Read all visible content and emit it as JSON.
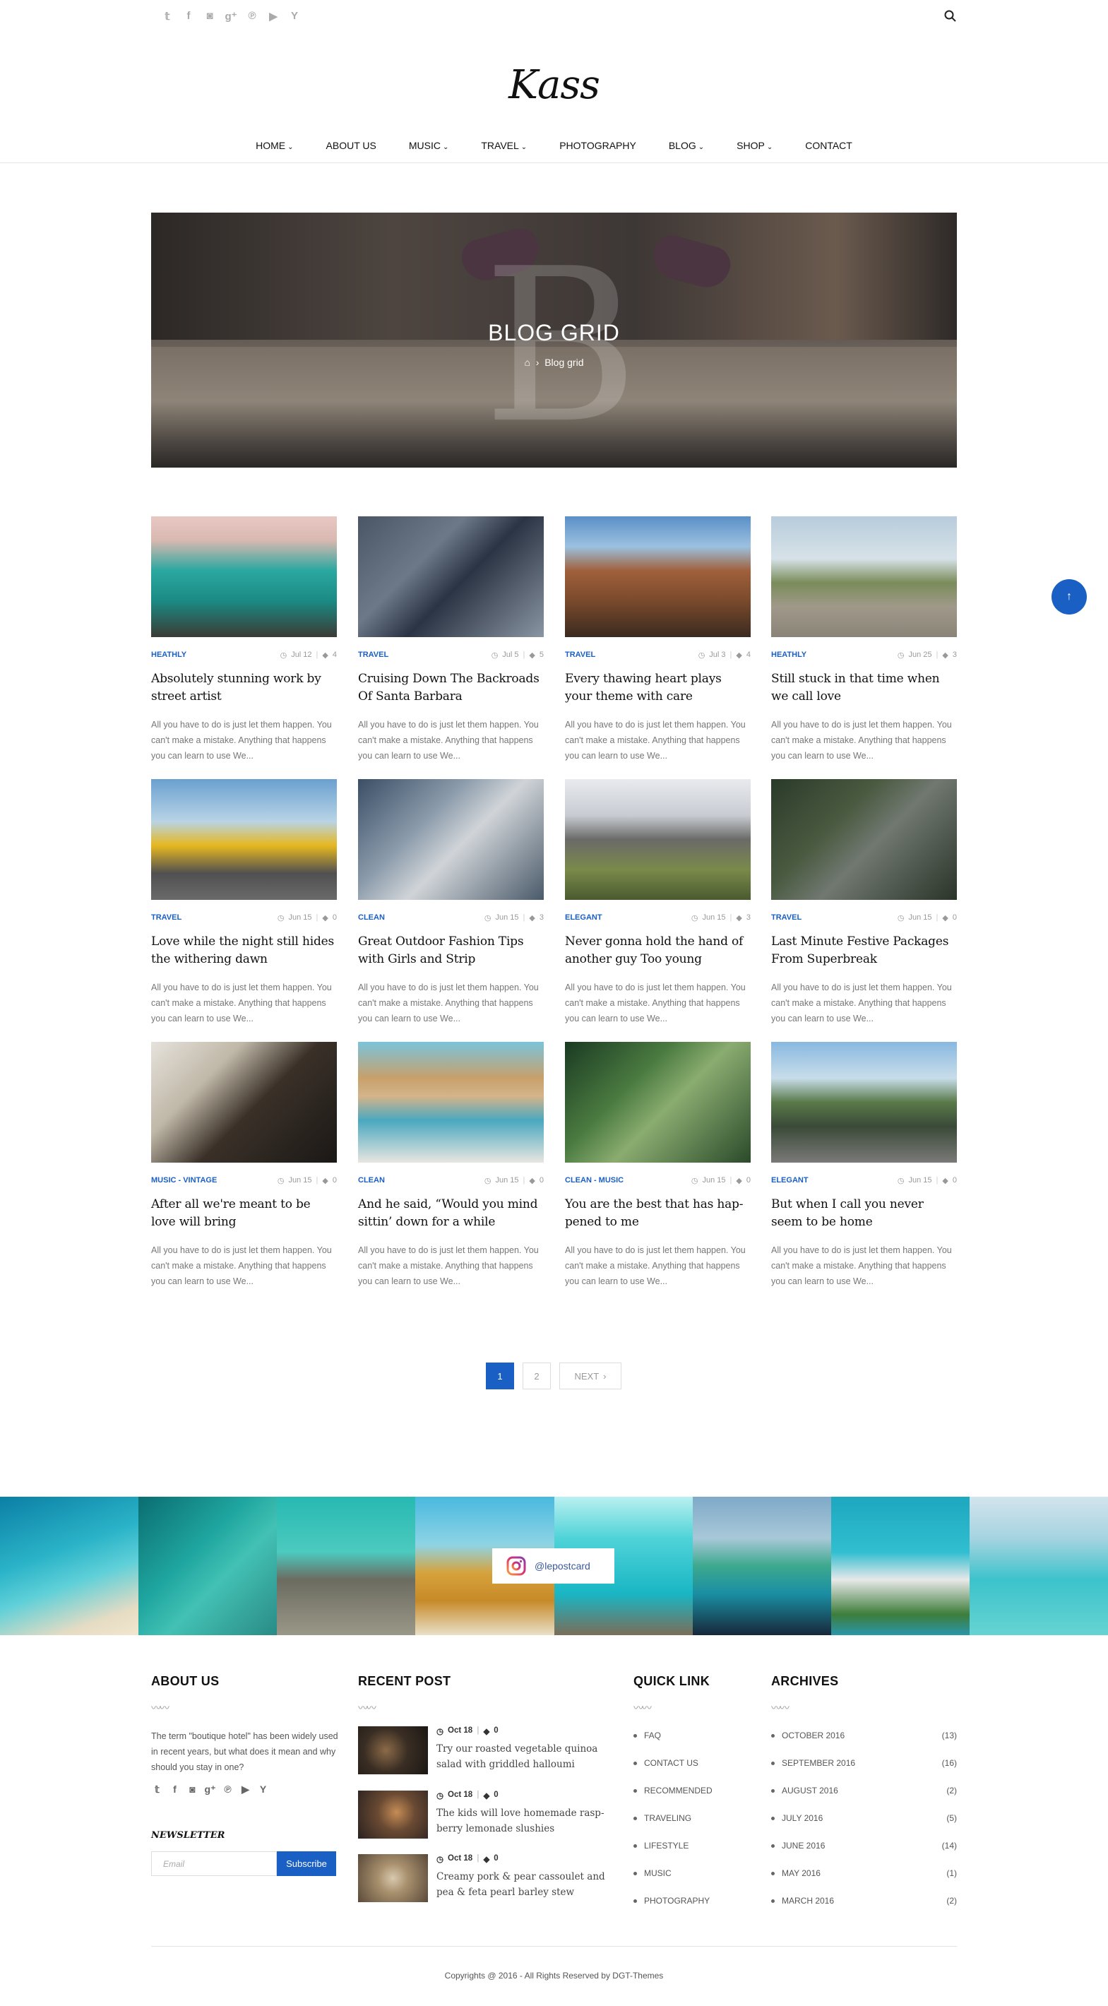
{
  "social_icons": [
    "twitter-icon",
    "facebook-icon",
    "instagram-icon",
    "google-plus-icon",
    "pinterest-icon",
    "youtube-icon",
    "hacker-news-icon"
  ],
  "site": {
    "logo": "Kass"
  },
  "nav": [
    {
      "label": "HOME",
      "dropdown": true
    },
    {
      "label": "ABOUT US",
      "dropdown": false
    },
    {
      "label": "MUSIC",
      "dropdown": true
    },
    {
      "label": "TRAVEL",
      "dropdown": true
    },
    {
      "label": "PHOTOGRAPHY",
      "dropdown": false
    },
    {
      "label": "BLOG",
      "dropdown": true
    },
    {
      "label": "SHOP",
      "dropdown": true
    },
    {
      "label": "CONTACT",
      "dropdown": false
    }
  ],
  "hero": {
    "title": "BLOG GRID",
    "breadcrumb": "Blog grid"
  },
  "colors": {
    "accent": "#1a5fc4"
  },
  "posts": [
    {
      "category": "HEATHLY",
      "date": "Jul 12",
      "comments": "4",
      "title": "Absolutely stunning work by street artist",
      "excerpt": "All you have to do is just let them happen. You can't make a mistake. Anything that happens you can learn to use We..."
    },
    {
      "category": "TRAVEL",
      "date": "Jul 5",
      "comments": "5",
      "title": "Cruising Down The Backroads Of Santa Barbara",
      "excerpt": "All you have to do is just let them happen. You can't make a mistake. Anything that happens you can learn to use We..."
    },
    {
      "category": "TRAVEL",
      "date": "Jul 3",
      "comments": "4",
      "title": "Every thawing heart plays your theme with care",
      "excerpt": "All you have to do is just let them happen. You can't make a mistake. Anything that happens you can learn to use We..."
    },
    {
      "category": "HEATHLY",
      "date": "Jun 25",
      "comments": "3",
      "title": "Still stuck in that time when we call love",
      "excerpt": "All you have to do is just let them happen. You can't make a mistake. Anything that happens you can learn to use We..."
    },
    {
      "category": "TRAVEL",
      "date": "Jun 15",
      "comments": "0",
      "title": "Love while the night still hides the withering dawn",
      "excerpt": "All you have to do is just let them happen. You can't make a mistake. Anything that happens you can learn to use We..."
    },
    {
      "category": "CLEAN",
      "date": "Jun 15",
      "comments": "3",
      "title": "Great Outdoor Fashion Tips with Girls and Strip",
      "excerpt": "All you have to do is just let them happen. You can't make a mistake. Anything that happens you can learn to use We..."
    },
    {
      "category": "ELEGANT",
      "date": "Jun 15",
      "comments": "3",
      "title": "Never gonna hold the hand of another guy Too young",
      "excerpt": "All you have to do is just let them happen. You can't make a mistake. Anything that happens you can learn to use We..."
    },
    {
      "category": "TRAVEL",
      "date": "Jun 15",
      "comments": "0",
      "title": "Last Minute Festive Packages From Superbreak",
      "excerpt": "All you have to do is just let them happen. You can't make a mistake. Anything that happens you can learn to use We..."
    },
    {
      "category": "MUSIC - VINTAGE",
      "date": "Jun 15",
      "comments": "0",
      "title": "After all we're meant to be love will bring",
      "excerpt": "All you have to do is just let them happen. You can't make a mistake. Anything that happens you can learn to use We..."
    },
    {
      "category": "CLEAN",
      "date": "Jun 15",
      "comments": "0",
      "title": "And he said, “Would you mind sittin’ down for a while",
      "excerpt": "All you have to do is just let them happen. You can't make a mistake. Anything that happens you can learn to use We..."
    },
    {
      "category": "CLEAN - MUSIC",
      "date": "Jun 15",
      "comments": "0",
      "title": "You are the best that has hap-pened to me",
      "excerpt": "All you have to do is just let them happen. You can't make a mistake. Anything that happens you can learn to use We..."
    },
    {
      "category": "ELEGANT",
      "date": "Jun 15",
      "comments": "0",
      "title": "But when I call you never seem to be home",
      "excerpt": "All you have to do is just let them happen. You can't make a mistake. Anything that happens you can learn to use We..."
    }
  ],
  "pagination": {
    "pages": [
      "1",
      "2"
    ],
    "current": "1",
    "next": "NEXT"
  },
  "instagram": {
    "handle": "@lepostcard"
  },
  "footer": {
    "about": {
      "heading": "ABOUT US",
      "text": "The term \"boutique hotel\" has been widely used in recent years, but what does it mean and why should you stay in one?"
    },
    "newsletter": {
      "heading": "NEWSLETTER",
      "placeholder": "Email",
      "button": "Subscribe"
    },
    "recent": {
      "heading": "RECENT POST",
      "items": [
        {
          "date": "Oct 18",
          "comments": "0",
          "title": "Try our roasted vegetable quinoa salad with griddled halloumi"
        },
        {
          "date": "Oct 18",
          "comments": "0",
          "title": "The kids will love homemade rasp-berry lemonade slushies"
        },
        {
          "date": "Oct 18",
          "comments": "0",
          "title": "Creamy pork & pear cassoulet and pea & feta pearl barley stew"
        }
      ]
    },
    "quick": {
      "heading": "QUICK LINK",
      "items": [
        "FAQ",
        "CONTACT US",
        "RECOMMENDED",
        "TRAVELING",
        "LIFESTYLE",
        "MUSIC",
        "PHOTOGRAPHY"
      ]
    },
    "archives": {
      "heading": "ARCHIVES",
      "items": [
        {
          "label": "OCTOBER 2016",
          "count": "(13)"
        },
        {
          "label": "SEPTEMBER 2016",
          "count": "(16)"
        },
        {
          "label": "AUGUST 2016",
          "count": "(2)"
        },
        {
          "label": "JULY 2016",
          "count": "(5)"
        },
        {
          "label": "JUNE 2016",
          "count": "(14)"
        },
        {
          "label": "MAY 2016",
          "count": "(1)"
        },
        {
          "label": "MARCH 2016",
          "count": "(2)"
        }
      ]
    },
    "copyright": "Copyrights @ 2016 - All Rights Reserved by DGT-Themes"
  }
}
